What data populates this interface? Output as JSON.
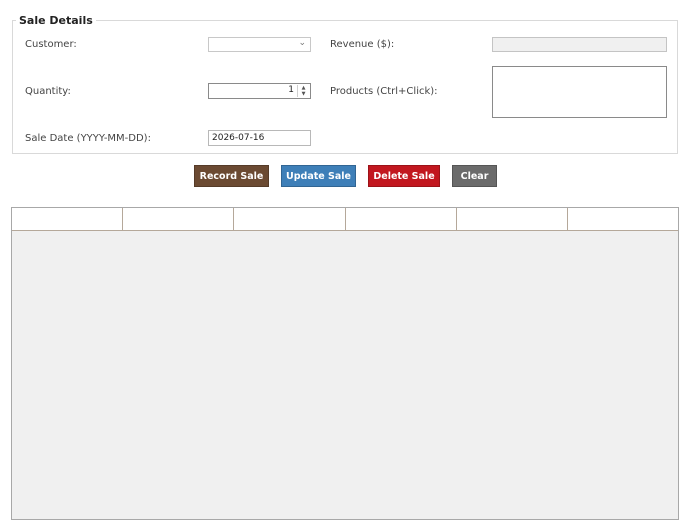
{
  "form": {
    "legend": "Sale Details",
    "customer_label": "Customer:",
    "customer_value": "",
    "revenue_label": "Revenue ($):",
    "revenue_value": "",
    "quantity_label": "Quantity:",
    "quantity_value": "1",
    "products_label": "Products (Ctrl+Click):",
    "products_items": [],
    "sale_date_label": "Sale Date (YYYY-MM-DD):",
    "sale_date_value": "2026-07-16"
  },
  "buttons": {
    "record": "Record Sale",
    "update": "Update Sale",
    "delete": "Delete Sale",
    "clear": "Clear"
  },
  "table": {
    "columns": [
      "",
      "",
      "",
      "",
      "",
      ""
    ],
    "rows": []
  },
  "colors": {
    "record": "#6b4a32",
    "update": "#3e7fb8",
    "delete": "#c2171f",
    "clear": "#6b6b6b"
  },
  "icons": {
    "customer_dropdown": "chevron-down-icon",
    "spin_up": "spin-up-icon",
    "spin_down": "spin-down-icon"
  }
}
